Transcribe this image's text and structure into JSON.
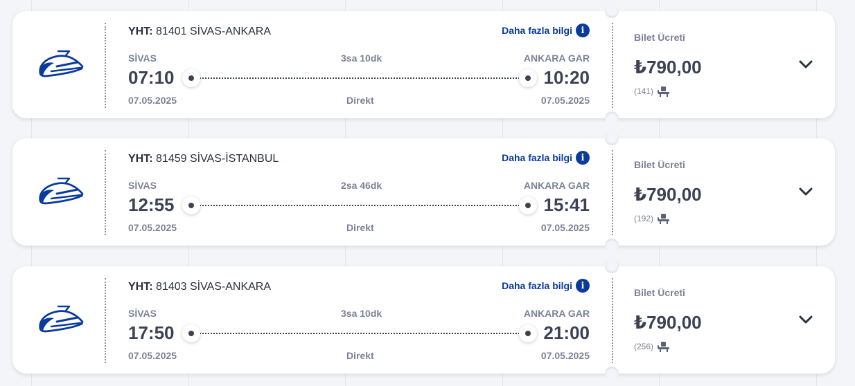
{
  "results": [
    {
      "train_type": "YHT:",
      "route": "81401 SİVAS-ANKARA",
      "more_info": "Daha fazla bilgi",
      "info_glyph": "i",
      "from_station": "SİVAS",
      "to_station": "ANKARA GAR",
      "dep_time": "07:10",
      "arr_time": "10:20",
      "duration": "3sa 10dk",
      "dep_date": "07.05.2025",
      "arr_date": "07.05.2025",
      "stop_type": "Direkt",
      "price_label": "Bilet Ücreti",
      "price": "₺790,00",
      "seats": "(141)"
    },
    {
      "train_type": "YHT:",
      "route": "81459 SİVAS-İSTANBUL",
      "more_info": "Daha fazla bilgi",
      "info_glyph": "i",
      "from_station": "SİVAS",
      "to_station": "ANKARA GAR",
      "dep_time": "12:55",
      "arr_time": "15:41",
      "duration": "2sa 46dk",
      "dep_date": "07.05.2025",
      "arr_date": "07.05.2025",
      "stop_type": "Direkt",
      "price_label": "Bilet Ücreti",
      "price": "₺790,00",
      "seats": "(192)"
    },
    {
      "train_type": "YHT:",
      "route": "81403 SİVAS-ANKARA",
      "more_info": "Daha fazla bilgi",
      "info_glyph": "i",
      "from_station": "SİVAS",
      "to_station": "ANKARA GAR",
      "dep_time": "17:50",
      "arr_time": "21:00",
      "duration": "3sa 10dk",
      "dep_date": "07.05.2025",
      "arr_date": "07.05.2025",
      "stop_type": "Direkt",
      "price_label": "Bilet Ücreti",
      "price": "₺790,00",
      "seats": "(256)"
    }
  ],
  "icons": {
    "train": "high-speed-train-icon",
    "seat": "seat-icon",
    "expand": "chevron-down-icon",
    "info": "info-icon"
  },
  "colors": {
    "brand_blue": "#0a3a9c",
    "text_dark": "#3c4254",
    "text_muted": "#7b8296",
    "background": "#f4f5f8"
  }
}
